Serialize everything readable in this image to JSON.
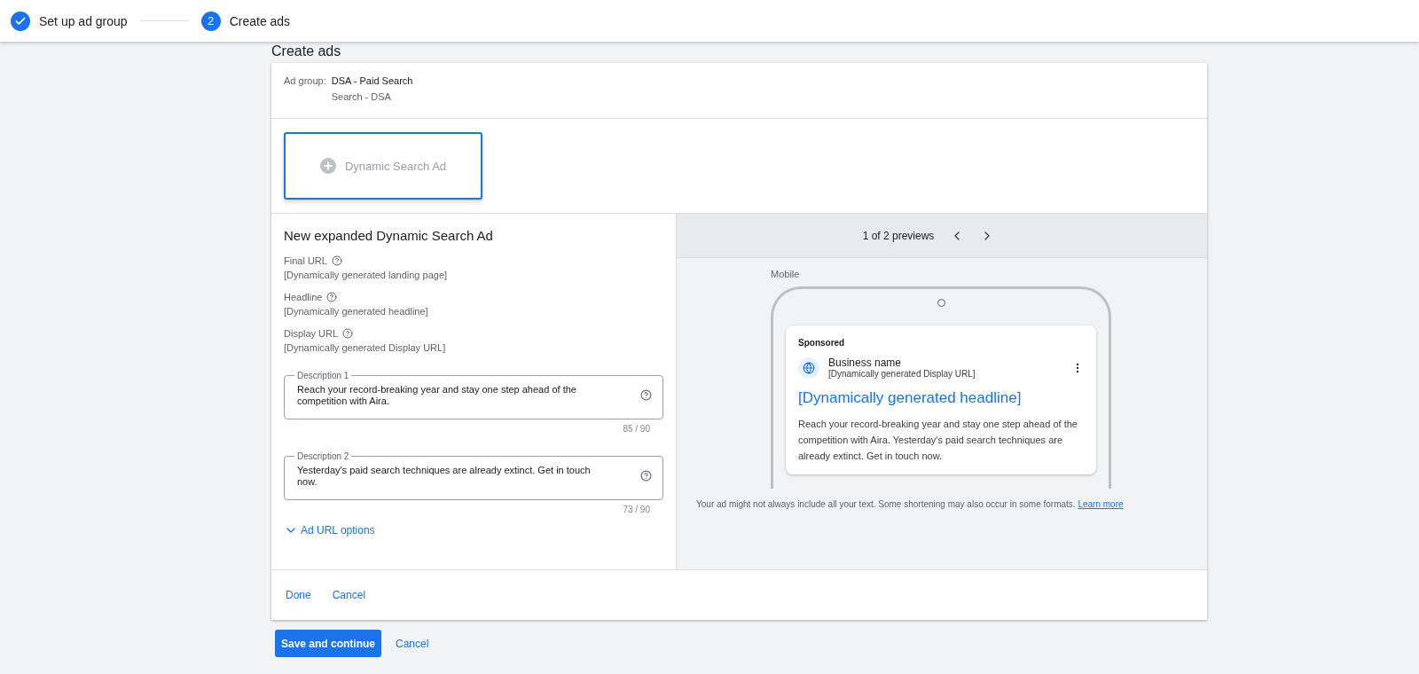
{
  "steps": [
    {
      "label": "Set up ad group",
      "done": true
    },
    {
      "label": "Create ads",
      "done": false,
      "number": "2"
    }
  ],
  "page_title": "Create ads",
  "ad_group": {
    "label": "Ad group:",
    "name": "DSA - Paid Search",
    "campaign": "Search - DSA"
  },
  "ad_type_tile": {
    "label": "Dynamic Search Ad",
    "selected": true
  },
  "editor": {
    "title": "New expanded Dynamic Search Ad",
    "info": [
      {
        "label": "Final URL",
        "value": "[Dynamically generated landing page]"
      },
      {
        "label": "Headline",
        "value": "[Dynamically generated headline]"
      },
      {
        "label": "Display URL",
        "value": "[Dynamically generated Display URL]"
      }
    ],
    "descriptions": [
      {
        "label": "Description 1",
        "value": "Reach your record-breaking year and stay one step ahead of the competition with Aira.",
        "count": "85 / 90"
      },
      {
        "label": "Description 2",
        "value": "Yesterday's paid search techniques are already extinct. Get in touch now.",
        "count": "73 / 90"
      }
    ],
    "url_options": {
      "label": "Ad URL options",
      "expanded": false
    }
  },
  "preview": {
    "counter": "1 of 2 previews",
    "device": "Mobile",
    "sponsored": "Sponsored",
    "business": "Business name",
    "display_url": "[Dynamically generated Display URL]",
    "headline": "[Dynamically generated headline]",
    "description": "Reach your record-breaking year and stay one step ahead of the competition with Aira. Yesterday's paid search techniques are already extinct. Get in touch now.",
    "note": "Your ad might not always include all your text. Some shortening may also occur in some formats.",
    "note_link": "Learn more"
  },
  "card_actions": [
    "Done",
    "Cancel"
  ],
  "page_actions": [
    {
      "label": "Save and continue",
      "kind": "primary"
    },
    {
      "label": "Cancel",
      "kind": "text"
    }
  ]
}
